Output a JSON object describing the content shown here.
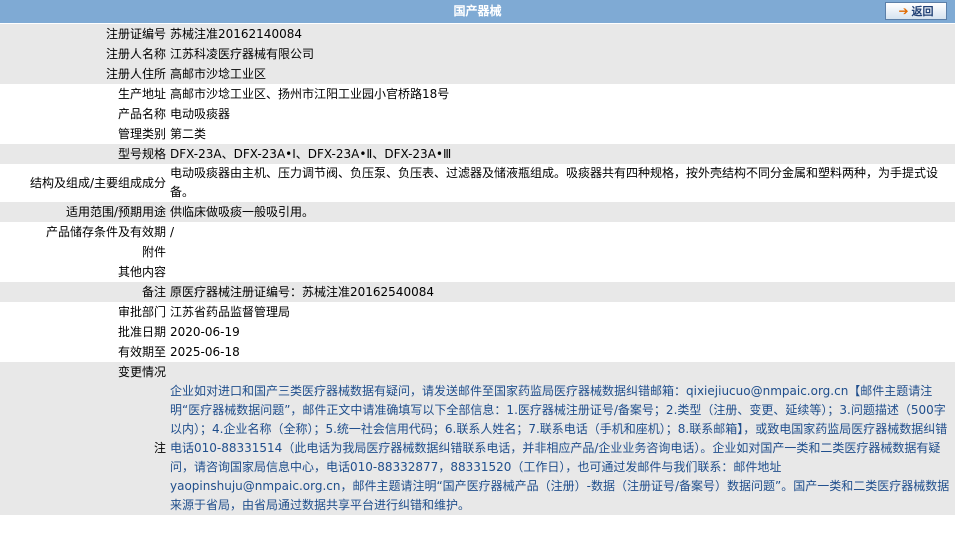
{
  "header": {
    "title": "国产器械",
    "back_label": "返回"
  },
  "rows": [
    {
      "label": "注册证编号",
      "value": "苏械注准20162140084"
    },
    {
      "label": "注册人名称",
      "value": "江苏科凌医疗器械有限公司"
    },
    {
      "label": "注册人住所",
      "value": "高邮市沙埝工业区"
    },
    {
      "label": "生产地址",
      "value": "高邮市沙埝工业区、扬州市江阳工业园小官桥路18号"
    },
    {
      "label": "产品名称",
      "value": "电动吸痰器"
    },
    {
      "label": "管理类别",
      "value": "第二类"
    },
    {
      "label": "型号规格",
      "value": "DFX-23A、DFX-23A•Ⅰ、DFX-23A•Ⅱ、DFX-23A•Ⅲ"
    },
    {
      "label": "结构及组成/主要组成成分",
      "value": "电动吸痰器由主机、压力调节阀、负压泵、负压表、过滤器及储液瓶组成。吸痰器共有四种规格，按外壳结构不同分金属和塑料两种，为手提式设备。"
    },
    {
      "label": "适用范围/预期用途",
      "value": "供临床做吸痰一般吸引用。"
    },
    {
      "label": "产品储存条件及有效期",
      "value": "/"
    },
    {
      "label": "附件",
      "value": ""
    },
    {
      "label": "其他内容",
      "value": ""
    },
    {
      "label": "备注",
      "value": "原医疗器械注册证编号：苏械注准20162540084"
    },
    {
      "label": "审批部门",
      "value": "江苏省药品监督管理局"
    },
    {
      "label": "批准日期",
      "value": "2020-06-19"
    },
    {
      "label": "有效期至",
      "value": "2025-06-18"
    },
    {
      "label": "变更情况",
      "value": ""
    }
  ],
  "note": {
    "label": "注",
    "text": "企业如对进口和国产三类医疗器械数据有疑问，请发送邮件至国家药监局医疗器械数据纠错邮箱：qixiejiucuo@nmpaic.org.cn【邮件主题请注明“医疗器械数据问题”，邮件正文中请准确填写以下全部信息：1.医疗器械注册证号/备案号；2.类型（注册、变更、延续等）；3.问题描述（500字以内）；4.企业名称（全称）；5.统一社会信用代码；6.联系人姓名；7.联系电话（手机和座机）；8.联系邮箱】，或致电国家药监局医疗器械数据纠错电话010-88331514（此电话为我局医疗器械数据纠错联系电话，并非相应产品/企业业务咨询电话）。企业如对国产一类和二类医疗器械数据有疑问，请咨询国家局信息中心，电话010-88332877，88331520（工作日），也可通过发邮件与我们联系：邮件地址yaopinshuju@nmpaic.org.cn，邮件主题请注明“国产医疗器械产品（注册）-数据（注册证号/备案号）数据问题”。国产一类和二类医疗器械数据来源于省局，由省局通过数据共享平台进行纠错和维护。"
  }
}
